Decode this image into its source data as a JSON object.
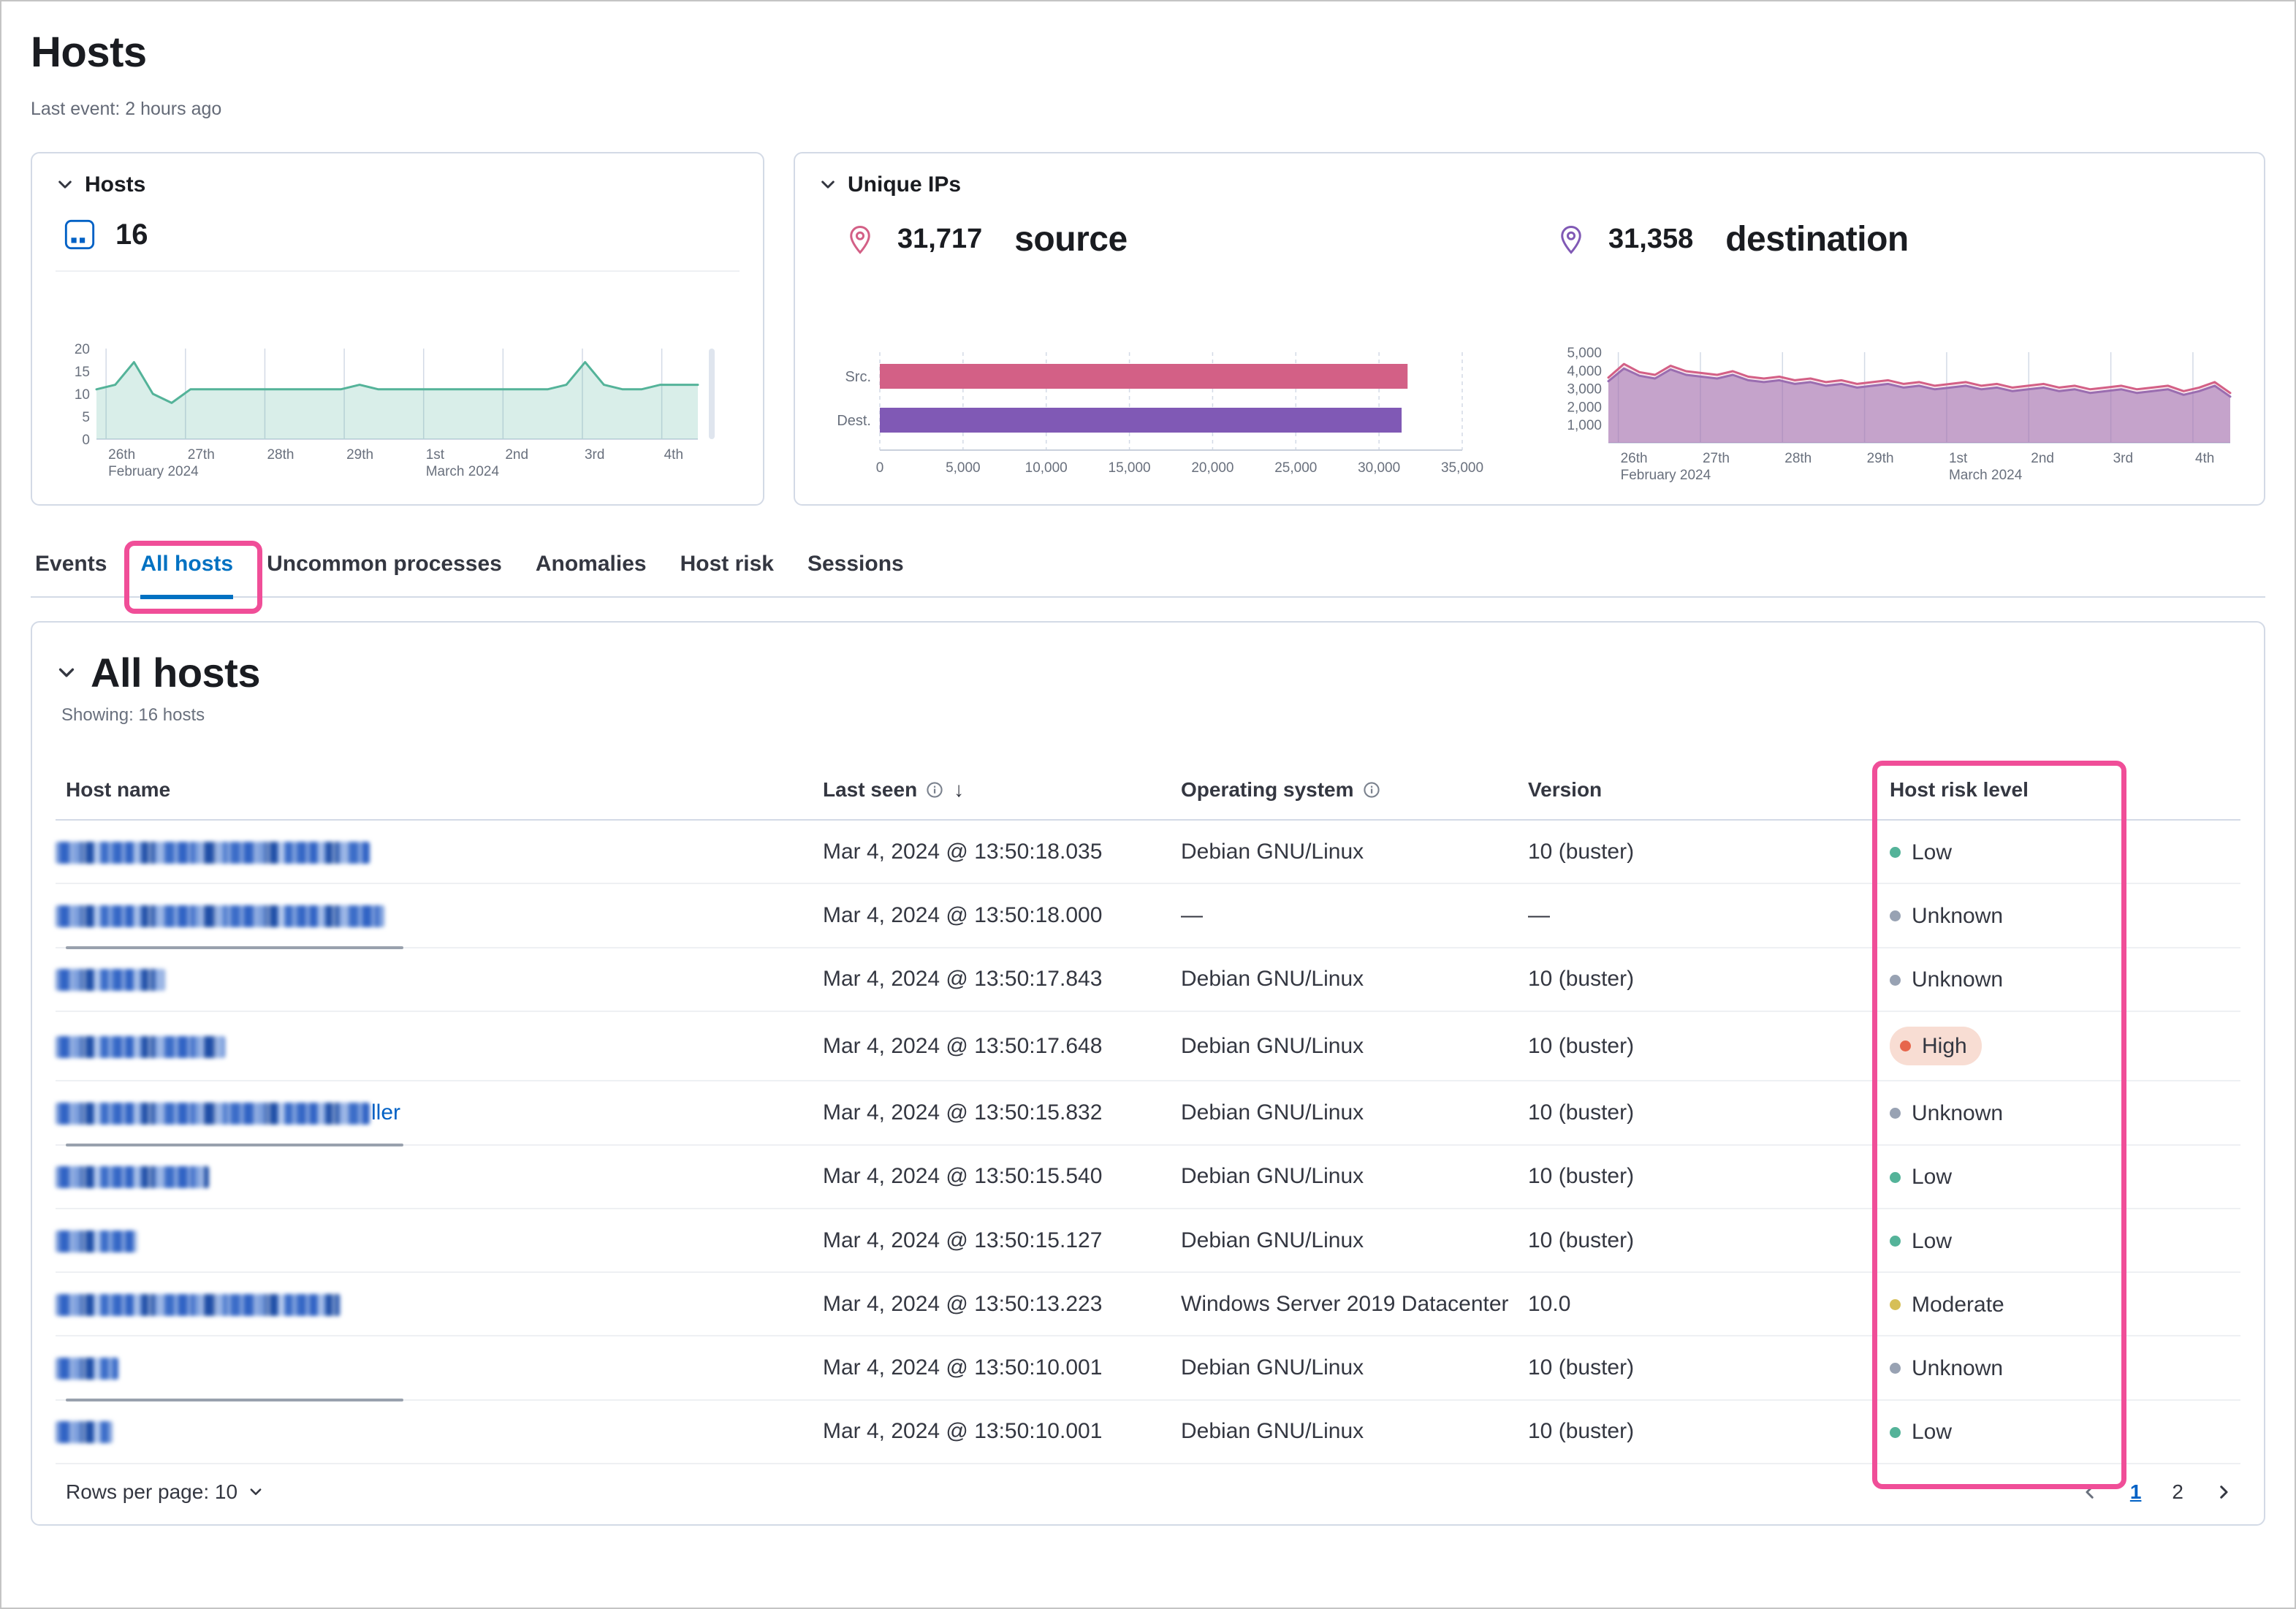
{
  "header": {
    "title": "Hosts",
    "last_event": "Last event: 2 hours ago"
  },
  "hosts_panel": {
    "title": "Hosts",
    "count": "16"
  },
  "unique_ips_panel": {
    "title": "Unique IPs",
    "source_value": "31,717",
    "source_label": "source",
    "dest_value": "31,358",
    "dest_label": "destination"
  },
  "tabs": [
    {
      "label": "Events",
      "active": false
    },
    {
      "label": "All hosts",
      "active": true
    },
    {
      "label": "Uncommon processes",
      "active": false
    },
    {
      "label": "Anomalies",
      "active": false
    },
    {
      "label": "Host risk",
      "active": false
    },
    {
      "label": "Sessions",
      "active": false
    }
  ],
  "all_hosts": {
    "title": "All hosts",
    "showing": "Showing: 16 hosts",
    "columns": {
      "host_name": "Host name",
      "last_seen": "Last seen",
      "operating_system": "Operating system",
      "version": "Version",
      "host_risk_level": "Host risk level"
    },
    "rows": [
      {
        "name_width": 430,
        "name_suffix": "",
        "name_bar": false,
        "last_seen": "Mar 4, 2024 @ 13:50:18.035",
        "os": "Debian GNU/Linux",
        "version": "10 (buster)",
        "risk": "Low"
      },
      {
        "name_width": 450,
        "name_suffix": "",
        "name_bar": true,
        "last_seen": "Mar 4, 2024 @ 13:50:18.000",
        "os": "—",
        "version": "—",
        "risk": "Unknown"
      },
      {
        "name_width": 150,
        "name_suffix": "",
        "name_bar": false,
        "last_seen": "Mar 4, 2024 @ 13:50:17.843",
        "os": "Debian GNU/Linux",
        "version": "10 (buster)",
        "risk": "Unknown"
      },
      {
        "name_width": 232,
        "name_suffix": "",
        "name_bar": false,
        "last_seen": "Mar 4, 2024 @ 13:50:17.648",
        "os": "Debian GNU/Linux",
        "version": "10 (buster)",
        "risk": "High"
      },
      {
        "name_width": 430,
        "name_suffix": "ller",
        "name_bar": true,
        "last_seen": "Mar 4, 2024 @ 13:50:15.832",
        "os": "Debian GNU/Linux",
        "version": "10 (buster)",
        "risk": "Unknown"
      },
      {
        "name_width": 210,
        "name_suffix": "",
        "name_bar": false,
        "last_seen": "Mar 4, 2024 @ 13:50:15.540",
        "os": "Debian GNU/Linux",
        "version": "10 (buster)",
        "risk": "Low"
      },
      {
        "name_width": 112,
        "name_suffix": "",
        "name_bar": false,
        "last_seen": "Mar 4, 2024 @ 13:50:15.127",
        "os": "Debian GNU/Linux",
        "version": "10 (buster)",
        "risk": "Low"
      },
      {
        "name_width": 390,
        "name_suffix": "",
        "name_bar": false,
        "last_seen": "Mar 4, 2024 @ 13:50:13.223",
        "os": "Windows Server 2019 Datacenter",
        "version": "10.0",
        "risk": "Moderate"
      },
      {
        "name_width": 86,
        "name_suffix": "",
        "name_bar": true,
        "last_seen": "Mar 4, 2024 @ 13:50:10.001",
        "os": "Debian GNU/Linux",
        "version": "10 (buster)",
        "risk": "Unknown"
      },
      {
        "name_width": 78,
        "name_suffix": "",
        "name_bar": false,
        "last_seen": "Mar 4, 2024 @ 13:50:10.001",
        "os": "Debian GNU/Linux",
        "version": "10 (buster)",
        "risk": "Low"
      }
    ]
  },
  "risk_colors": {
    "Low": "#54b399",
    "Unknown": "#98a2b3",
    "Moderate": "#d6bf57",
    "High": "#e7664c"
  },
  "pagination": {
    "rows_per_page": "Rows per page: 10",
    "pages": [
      "1",
      "2"
    ],
    "active_page": "1"
  },
  "ui_colors": {
    "link": "#0061c5",
    "active_tab": "#0071c2",
    "annotation": "#f04e98",
    "high_pill_bg": "#f8ddd3"
  },
  "chart_data": [
    {
      "id": "hosts_over_time",
      "type": "area",
      "title": "Hosts over time",
      "ylim": [
        0,
        20
      ],
      "yticks": [
        0,
        5,
        10,
        15,
        20
      ],
      "yticklabels": [
        "0",
        "5",
        "10",
        "15",
        "20"
      ],
      "xticklabels": [
        "26th\nFebruary 2024",
        "27th",
        "28th",
        "29th",
        "1st\nMarch 2024",
        "2nd",
        "3rd",
        "4th"
      ],
      "grid": "vertical",
      "legend": "none",
      "scrollbar": true,
      "series": [
        {
          "name": "hosts",
          "color": "#54b399",
          "fill": "rgba(84,179,153,0.22)",
          "values": [
            11,
            12,
            17,
            10,
            8,
            11,
            11,
            11,
            11,
            11,
            11,
            11,
            11,
            11,
            12,
            11,
            11,
            11,
            11,
            11,
            11,
            11,
            11,
            11,
            11,
            12,
            17,
            12,
            11,
            11,
            12,
            12,
            12
          ]
        }
      ]
    },
    {
      "id": "unique_ips_bar",
      "type": "bar",
      "orientation": "horizontal",
      "categories": [
        "Src.",
        "Dest."
      ],
      "values": [
        31717,
        31358
      ],
      "colors": [
        "#d36086",
        "#8059b5"
      ],
      "xlim": [
        0,
        35000
      ],
      "xticks": [
        0,
        5000,
        10000,
        15000,
        20000,
        25000,
        30000,
        35000
      ],
      "xticklabels": [
        "0",
        "5,000",
        "10,000",
        "15,000",
        "20,000",
        "25,000",
        "30,000",
        "35,000"
      ],
      "grid": "vertical-dashed",
      "legend": "none"
    },
    {
      "id": "unique_ips_over_time",
      "type": "area",
      "ylim": [
        0,
        5000
      ],
      "yticks": [
        1000,
        2000,
        3000,
        4000,
        5000
      ],
      "yticklabels": [
        "1,000",
        "2,000",
        "3,000",
        "4,000",
        "5,000"
      ],
      "xticklabels": [
        "26th\nFebruary 2024",
        "27th",
        "28th",
        "29th",
        "1st\nMarch 2024",
        "2nd",
        "3rd",
        "4th"
      ],
      "grid": "vertical",
      "legend": "none",
      "series": [
        {
          "name": "destination",
          "color": "#9170b8",
          "fill": "rgba(145,112,184,0.55)",
          "values": [
            3400,
            4100,
            3700,
            3550,
            4050,
            3750,
            3650,
            3550,
            3750,
            3450,
            3350,
            3450,
            3250,
            3350,
            3150,
            3250,
            3050,
            3150,
            3250,
            3050,
            3150,
            2950,
            3050,
            3150,
            2950,
            3050,
            2850,
            2950,
            3050,
            2850,
            2950,
            2750,
            2850,
            2950,
            2750,
            2850,
            2950,
            2650,
            2850,
            3150,
            2550
          ]
        },
        {
          "name": "source",
          "color": "#d36086",
          "fill": "rgba(211,96,134,0.15)",
          "values": [
            3600,
            4350,
            3900,
            3750,
            4250,
            3950,
            3850,
            3750,
            3950,
            3650,
            3550,
            3650,
            3450,
            3550,
            3350,
            3450,
            3250,
            3350,
            3450,
            3250,
            3350,
            3150,
            3250,
            3350,
            3150,
            3250,
            3050,
            3150,
            3250,
            3050,
            3150,
            2950,
            3050,
            3150,
            2950,
            3050,
            3150,
            2850,
            3050,
            3350,
            2750
          ]
        }
      ]
    }
  ]
}
